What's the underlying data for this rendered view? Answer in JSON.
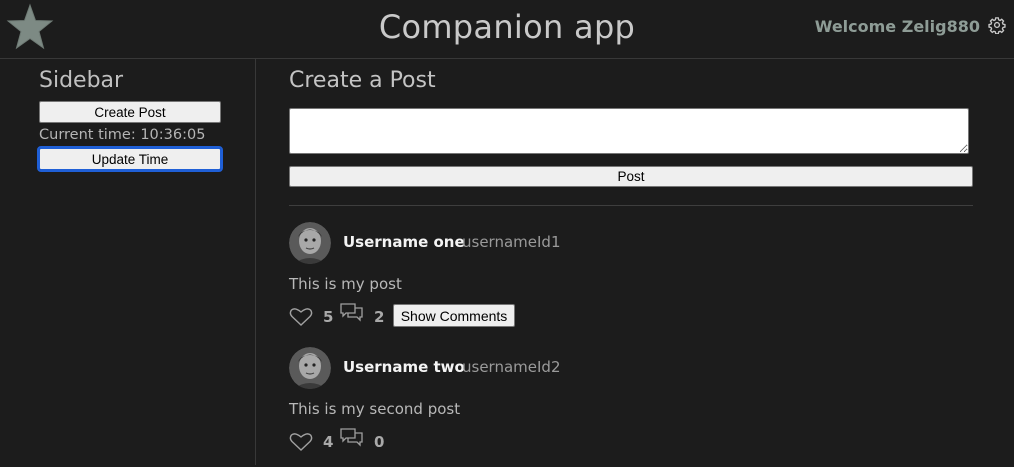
{
  "header": {
    "app_title": "Companion app",
    "welcome_text": "Welcome Zelig880",
    "icons": {
      "logo": "star-icon",
      "settings": "gear-icon"
    }
  },
  "sidebar": {
    "title": "Sidebar",
    "create_post_label": "Create Post",
    "current_time_label": "Current time: 10:36:05",
    "update_time_label": "Update Time"
  },
  "main": {
    "section_title": "Create a Post",
    "textarea_value": "",
    "post_button_label": "Post",
    "posts": [
      {
        "username": "Username one",
        "handle": "usernameId1",
        "text": "This is my post",
        "likes": "5",
        "comments": "2",
        "show_comments_label": "Show Comments"
      },
      {
        "username": "Username two",
        "handle": "usernameId2",
        "text": "This is my second post",
        "likes": "4",
        "comments": "0"
      }
    ]
  },
  "colors": {
    "background": "#1c1c1c",
    "welcome_text": "#8e9c96",
    "focus_outline": "#1f5fd6"
  }
}
